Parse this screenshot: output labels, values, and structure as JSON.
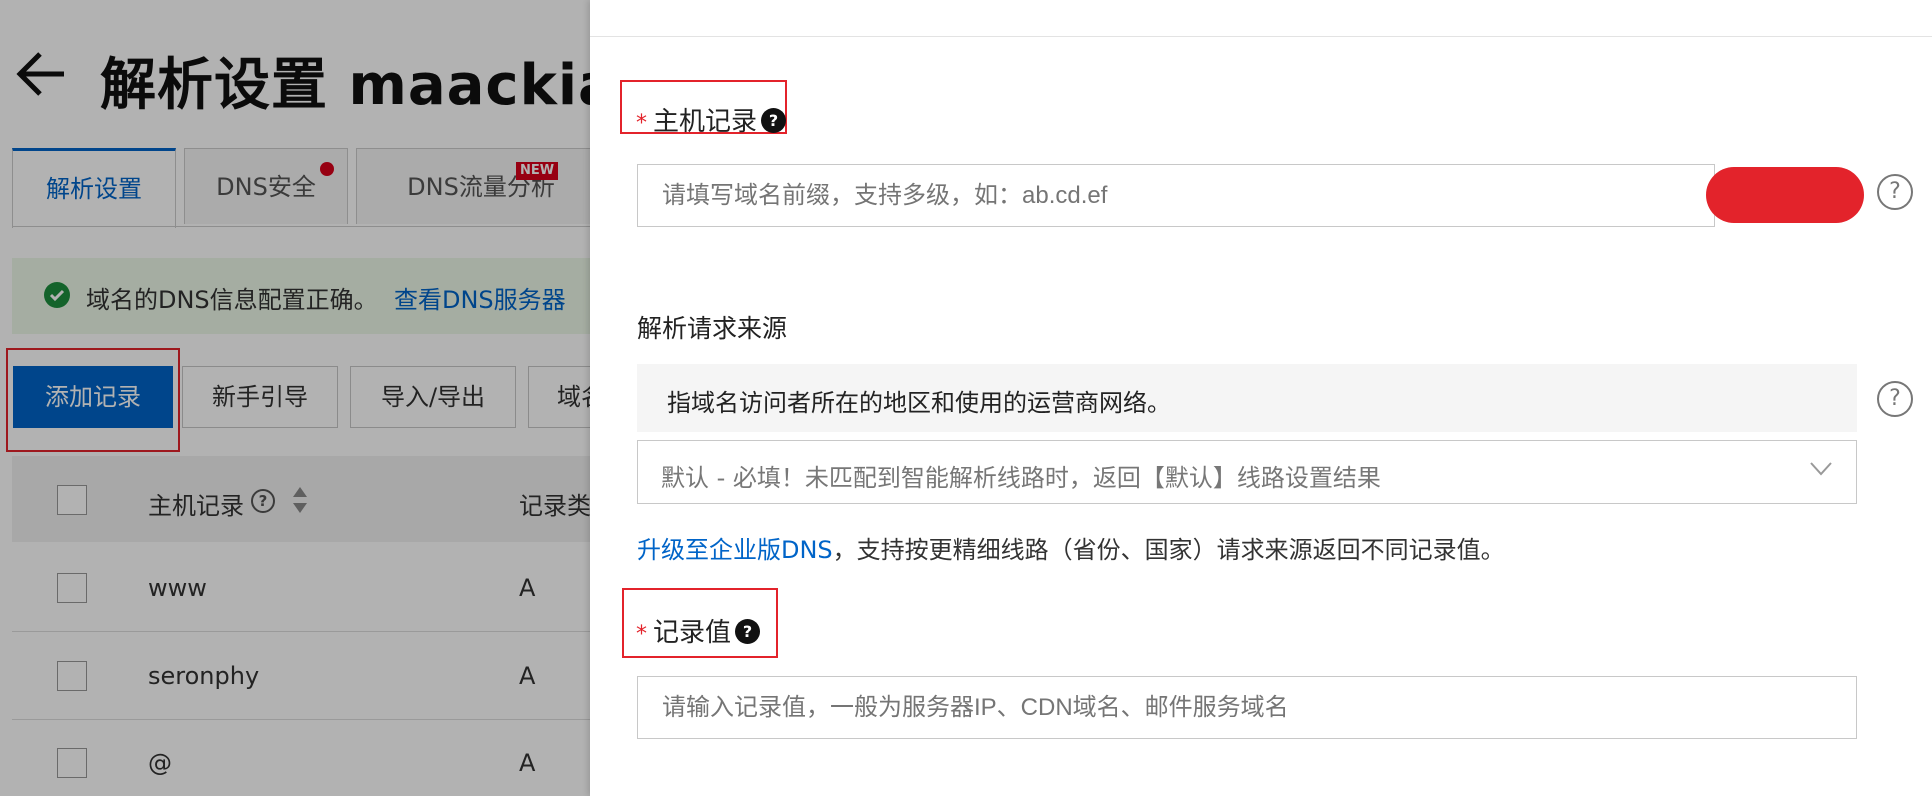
{
  "background_page": {
    "title": "解析设置 maackia.",
    "tabs": [
      {
        "label": "解析设置",
        "active": true
      },
      {
        "label": "DNS安全",
        "badge": "dot"
      },
      {
        "label": "DNS流量分析",
        "badge": "NEW"
      }
    ],
    "status_banner": {
      "text": "域名的DNS信息配置正确。",
      "link": "查看DNS服务器"
    },
    "toolbar": {
      "add_record": "添加记录",
      "guide": "新手引导",
      "import_export": "导入/导出",
      "domain_partial": "域名"
    },
    "table": {
      "columns": [
        "主机记录",
        "记录类"
      ],
      "rows": [
        {
          "host": "www",
          "type": "A"
        },
        {
          "host": "seronphy",
          "type": "A"
        },
        {
          "host": "@",
          "type": "A"
        }
      ]
    }
  },
  "drawer": {
    "host_record": {
      "label": "主机记录",
      "required_mark": "*",
      "placeholder": "请填写域名前缀，支持多级，如：ab.cd.ef"
    },
    "request_source": {
      "label": "解析请求来源",
      "description": "指域名访问者所在的地区和使用的运营商网络。",
      "selected": "默认 - 必填！未匹配到智能解析线路时，返回【默认】线路设置结果"
    },
    "upgrade": {
      "link": "升级至企业版DNS",
      "text": "，支持按更精细线路（省份、国家）请求来源返回不同记录值。"
    },
    "record_value": {
      "label": "记录值",
      "required_mark": "*",
      "placeholder": "请输入记录值，一般为服务器IP、CDN域名、邮件服务域名"
    }
  },
  "colors": {
    "primary": "#0064c8",
    "highlight": "#e3232b",
    "success": "#1e8e3e",
    "overlay": "rgba(0,0,0,0.30)"
  }
}
